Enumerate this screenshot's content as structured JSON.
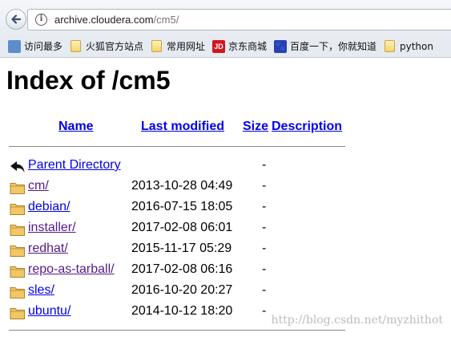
{
  "browser": {
    "url_host": "archive.cloudera.com",
    "url_path": "/cm5/",
    "bookmarks": [
      {
        "label": "访问最多",
        "icon": "bookmark-icon"
      },
      {
        "label": "火狐官方站点",
        "icon": "folder-icon"
      },
      {
        "label": "常用网址",
        "icon": "folder-icon"
      },
      {
        "label": "京东商城",
        "icon": "jd-icon",
        "icon_text": "JD"
      },
      {
        "label": "百度一下，你就知道",
        "icon": "baidu-paw-icon",
        "icon_text": "🐾"
      },
      {
        "label": "python",
        "icon": "folder-icon"
      }
    ]
  },
  "page": {
    "title": "Index of /cm5",
    "columns": {
      "name": "Name",
      "last_modified": "Last modified",
      "size": "Size",
      "description": "Description"
    },
    "entries": [
      {
        "name": "Parent Directory",
        "date": "",
        "size": "-",
        "icon": "back-arrow-icon",
        "visited": false
      },
      {
        "name": "cm/",
        "date": "2013-10-28 04:49",
        "size": "-",
        "icon": "folder-icon",
        "visited": true
      },
      {
        "name": "debian/",
        "date": "2016-07-15 18:05",
        "size": "-",
        "icon": "folder-icon",
        "visited": false
      },
      {
        "name": "installer/",
        "date": "2017-02-08 06:01",
        "size": "-",
        "icon": "folder-icon",
        "visited": true
      },
      {
        "name": "redhat/",
        "date": "2015-11-17 05:29",
        "size": "-",
        "icon": "folder-icon",
        "visited": true
      },
      {
        "name": "repo-as-tarball/",
        "date": "2017-02-08 06:16",
        "size": "-",
        "icon": "folder-icon",
        "visited": true
      },
      {
        "name": "sles/",
        "date": "2016-10-20 20:27",
        "size": "-",
        "icon": "folder-icon",
        "visited": false
      },
      {
        "name": "ubuntu/",
        "date": "2014-10-12 18:20",
        "size": "-",
        "icon": "folder-icon",
        "visited": false
      }
    ]
  },
  "watermark": "http://blog.csdn.net/myzhithot",
  "colors": {
    "link": "#0000ee",
    "visited_link": "#551a8b",
    "folder_fill": "#f2c766",
    "folder_stroke": "#b0812a"
  }
}
